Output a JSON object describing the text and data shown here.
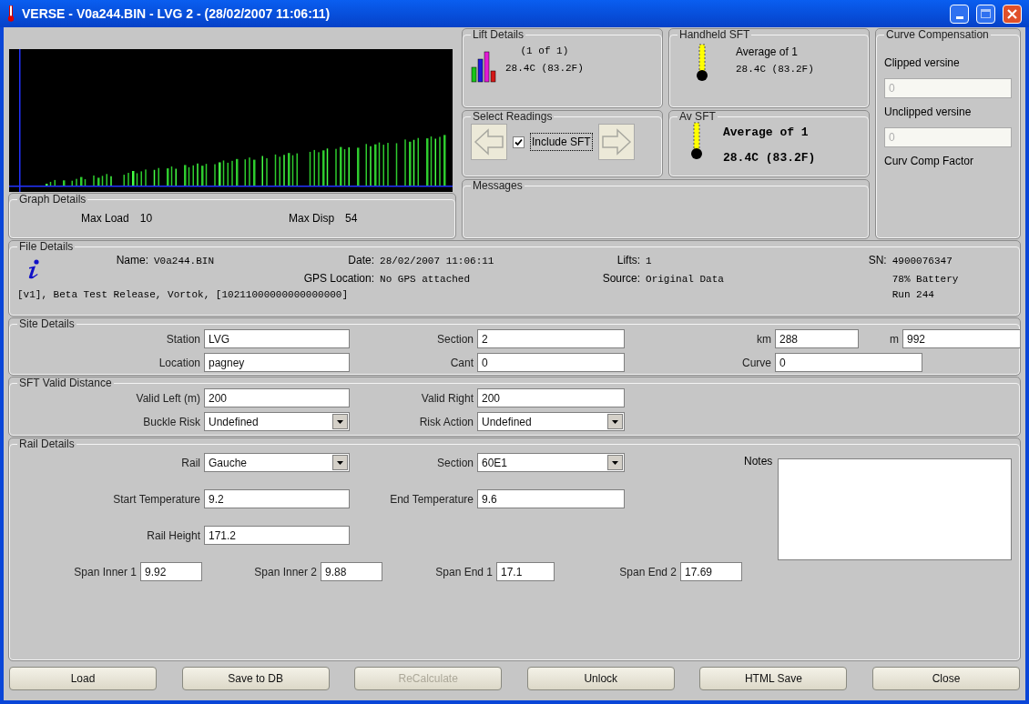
{
  "window": {
    "title": "VERSE - V0a244.BIN - LVG 2 - (28/02/2007 11:06:11)"
  },
  "graph_details": {
    "title": "Graph Details",
    "items": [
      {
        "label": "Max Load",
        "value": "10"
      },
      {
        "label": "Max Disp",
        "value": "54"
      }
    ]
  },
  "lift_details": {
    "title": "Lift Details",
    "count": "(1 of 1)",
    "reading": "28.4C (83.2F)"
  },
  "handheld_sft": {
    "title": "Handheld SFT",
    "average": "Average of 1",
    "reading": "28.4C (83.2F)"
  },
  "select_readings": {
    "title": "Select Readings",
    "include_sft": {
      "label": "Include SFT",
      "checked": true
    }
  },
  "av_sft": {
    "title": "Av SFT",
    "average": "Average of 1",
    "reading": "28.4C (83.2F)"
  },
  "messages": {
    "title": "Messages"
  },
  "curve_compensation": {
    "title": "Curve Compensation",
    "fields": [
      {
        "label": "Clipped versine",
        "value": "0",
        "disabled": true
      },
      {
        "label": "Unclipped versine",
        "value": "0",
        "disabled": true
      }
    ],
    "factor_label": "Curv Comp Factor"
  },
  "file_details": {
    "title": "File Details",
    "name": {
      "label": "Name:",
      "value": "V0a244.BIN"
    },
    "date": {
      "label": "Date:",
      "value": "28/02/2007 11:06:11"
    },
    "gps": {
      "label": "GPS Location:",
      "value": "No GPS attached"
    },
    "lifts": {
      "label": "Lifts:",
      "value": "1"
    },
    "source": {
      "label": "Source:",
      "value": "Original Data"
    },
    "sn": {
      "label": "SN:",
      "value": "4900076347"
    },
    "sn_lines": [
      "78% Battery",
      "Run 244"
    ],
    "footer": "[v1], Beta Test Release, Vortok, [10211000000000000000]"
  },
  "site_details": {
    "title": "Site Details",
    "rows": [
      [
        {
          "kind": "text",
          "label": "Station",
          "value": "LVG"
        },
        {
          "kind": "text",
          "label": "Section",
          "value": "2"
        },
        {
          "kind": "text",
          "label": "km",
          "value": "288"
        },
        {
          "kind": "text",
          "label": "m",
          "value": "992"
        }
      ],
      [
        {
          "kind": "text",
          "label": "Location",
          "value": "pagney"
        },
        {
          "kind": "text",
          "label": "Cant",
          "value": "0"
        },
        {
          "kind": "text",
          "label": "Curve",
          "value": "0"
        }
      ]
    ]
  },
  "sft_valid_distance": {
    "title": "SFT Valid Distance",
    "rows": [
      [
        {
          "kind": "text",
          "label": "Valid Left (m)",
          "value": "200"
        },
        {
          "kind": "text",
          "label": "Valid Right",
          "value": "200"
        }
      ],
      [
        {
          "kind": "select",
          "label": "Buckle Risk",
          "value": "Undefined"
        },
        {
          "kind": "select",
          "label": "Risk Action",
          "value": "Undefined"
        }
      ]
    ]
  },
  "rail_details": {
    "title": "Rail Details",
    "rows": [
      [
        {
          "kind": "select",
          "label": "Rail",
          "value": "Gauche"
        },
        {
          "kind": "select",
          "label": "Section",
          "value": "60E1"
        }
      ],
      [
        {
          "kind": "text",
          "label": "Start Temperature",
          "value": "9.2"
        },
        {
          "kind": "text",
          "label": "End Temperature",
          "value": "9.6"
        }
      ],
      [
        {
          "kind": "text",
          "label": "Rail Height",
          "value": "171.2"
        }
      ]
    ],
    "spans": [
      {
        "label": "Span Inner 1",
        "value": "9.92"
      },
      {
        "label": "Span Inner 2",
        "value": "9.88"
      },
      {
        "label": "Span End 1",
        "value": "17.1"
      },
      {
        "label": "Span End 2",
        "value": "17.69"
      }
    ],
    "notes": {
      "label": "Notes"
    }
  },
  "buttons": [
    {
      "label": "Load",
      "disabled": false
    },
    {
      "label": "Save to DB",
      "disabled": false
    },
    {
      "label": "ReCalculate",
      "disabled": true
    },
    {
      "label": "Unlock",
      "disabled": false
    },
    {
      "label": "HTML Save",
      "disabled": false
    },
    {
      "label": "Close",
      "disabled": false
    }
  ]
}
